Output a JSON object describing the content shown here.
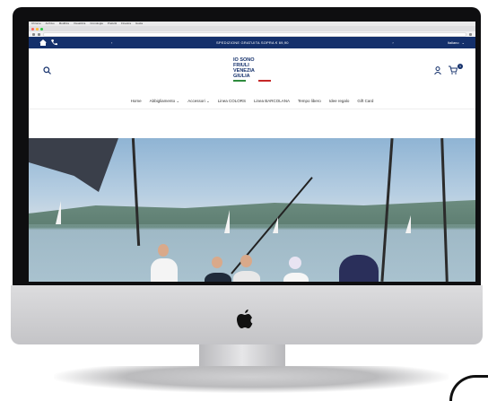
{
  "browser": {
    "menu_items": [
      "Chrome",
      "Archivo",
      "Modifica",
      "Visualizza",
      "Cronologia",
      "Preferiti",
      "Finestra",
      "Guida"
    ]
  },
  "site": {
    "topbar": {
      "promo": "SPEDIZIONE GRATUITA SOPRA € 69,90",
      "language": "Italiano"
    },
    "logo_lines": [
      "IO SONO",
      "FRIULI",
      "VENEZIA",
      "GIULIA"
    ],
    "nav": [
      "Home",
      "Abbigliamento",
      "Accessori",
      "Linea COLORS",
      "Linea BARCOLANA",
      "Tempo libero",
      "Idee regalo",
      "Gift Card"
    ],
    "cart_count": "1"
  },
  "colors": {
    "brand_navy": "#14306b",
    "flag_green": "#2e8b3d",
    "flag_red": "#c62828"
  },
  "icons": [
    "home-icon",
    "phone-icon",
    "search-icon",
    "account-icon",
    "cart-icon",
    "apple-logo-icon"
  ]
}
